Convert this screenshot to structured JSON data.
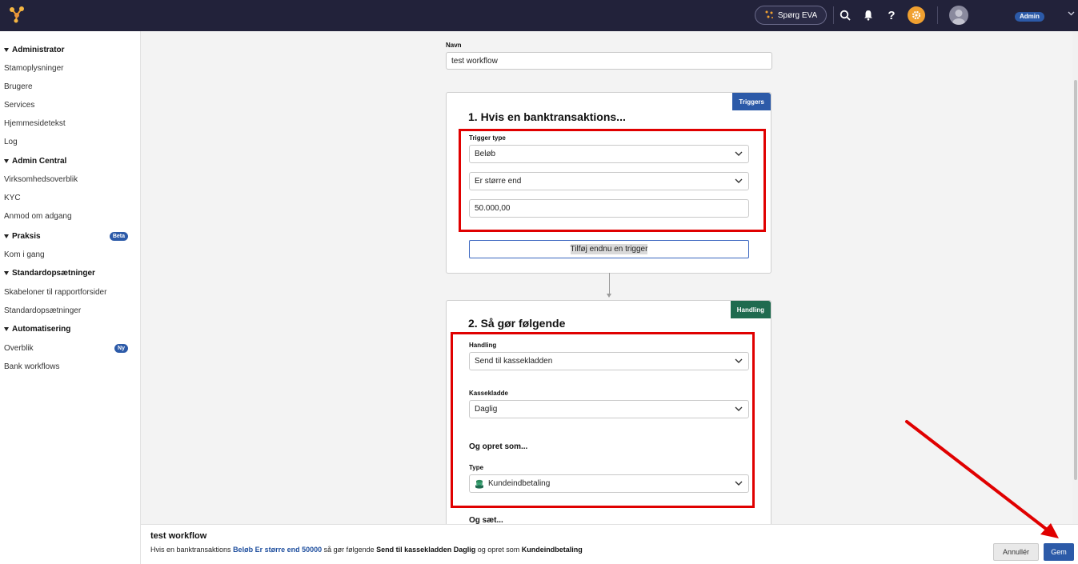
{
  "topbar": {
    "eva_label": "Spørg EVA",
    "admin_badge": "Admin"
  },
  "sidebar": {
    "groups": [
      {
        "label": "Administrator",
        "items": [
          "Stamoplysninger",
          "Brugere",
          "Services",
          "Hjemmesidetekst",
          "Log"
        ]
      },
      {
        "label": "Admin Central",
        "items": [
          "Virksomhedsoverblik",
          "KYC",
          "Anmod om adgang"
        ]
      },
      {
        "label": "Praksis",
        "badge": "Beta",
        "items": [
          "Kom i gang"
        ]
      },
      {
        "label": "Standardopsætninger",
        "items": [
          "Skabeloner til rapportforsider",
          "Standardopsætninger"
        ]
      },
      {
        "label": "Automatisering",
        "items": [
          "Overblik",
          "Bank workflows"
        ],
        "item_badge": "Ny"
      }
    ]
  },
  "form": {
    "name_label": "Navn",
    "name_value": "test workflow"
  },
  "trigger_card": {
    "tag": "Triggers",
    "title": "1. Hvis en banktransaktions...",
    "trigger_type_label": "Trigger type",
    "trigger_type_value": "Beløb",
    "operator_value": "Er større end",
    "amount_value": "50.000,00",
    "add_trigger_label": "Tilføj endnu en trigger"
  },
  "action_card": {
    "tag": "Handling",
    "title": "2. Så gør følgende",
    "handling_label": "Handling",
    "handling_value": "Send til kassekladden",
    "kassekladde_label": "Kassekladde",
    "kassekladde_value": "Daglig",
    "create_as_heading": "Og opret som...",
    "type_label": "Type",
    "type_value": "Kundeindbetaling",
    "and_set_heading": "Og sæt..."
  },
  "footer": {
    "title": "test workflow",
    "summary_1": "Hvis en banktransaktions ",
    "summary_2": "Beløb Er større end 50000",
    "summary_3": " så gør følgende ",
    "summary_4": "Send til kassekladden Daglig",
    "summary_5": " og opret som ",
    "summary_6": "Kundeindbetaling",
    "cancel_label": "Annullér",
    "save_label": "Gem"
  },
  "colors": {
    "topbar": "#22223a",
    "accent_blue": "#2c5aa8",
    "handling_green": "#1f6b4f",
    "highlight_red": "#e00000",
    "gear_orange": "#f0a030"
  },
  "icons": [
    "app-logo-icon",
    "sparkle-icon",
    "search-icon",
    "bell-icon",
    "help-icon",
    "gear-icon",
    "avatar-icon",
    "chevron-down-icon",
    "coins-icon"
  ]
}
